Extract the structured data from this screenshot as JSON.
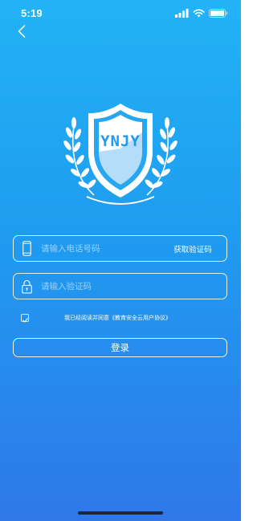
{
  "status_bar": {
    "time": "5:19"
  },
  "logo": {
    "text": "YNJY"
  },
  "phone_field": {
    "placeholder": "请输入电话号码",
    "get_code_label": "获取验证码"
  },
  "code_field": {
    "placeholder": "请输入验证码"
  },
  "agreement": {
    "checked": true,
    "text": "我已经阅读并同意《教育安全云用户协议》"
  },
  "login": {
    "label": "登录"
  },
  "icons": [
    "chevron-left-icon",
    "signal-icon",
    "wifi-icon",
    "battery-icon",
    "phone-icon",
    "lock-icon",
    "checkmark-icon"
  ],
  "colors": {
    "background_top": "#22b3f5",
    "background_bottom": "#2f78ea",
    "foreground": "#ffffff"
  }
}
